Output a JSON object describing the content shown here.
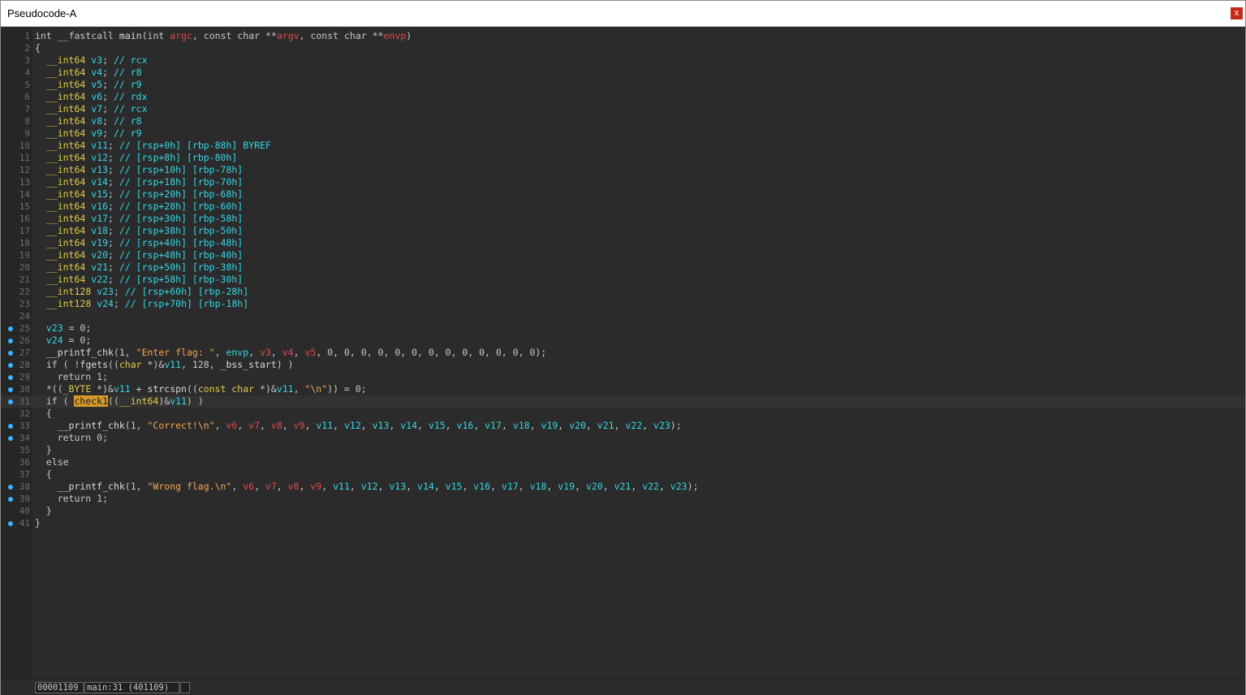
{
  "window": {
    "title": "Pseudocode-A",
    "close_label": "x"
  },
  "status": {
    "address": "00001109",
    "location": "main:31 (401109)",
    "extra": ""
  },
  "lines": [
    {
      "n": "1",
      "bp": false,
      "tokens": [
        [
          "k",
          "int"
        ],
        [
          "n",
          " "
        ],
        [
          "k",
          "__fastcall"
        ],
        [
          "n",
          " "
        ],
        [
          "f",
          "main"
        ],
        [
          "n",
          "("
        ],
        [
          "k",
          "int"
        ],
        [
          "n",
          " "
        ],
        [
          "a",
          "argc"
        ],
        [
          "n",
          ", "
        ],
        [
          "k",
          "const"
        ],
        [
          "n",
          " "
        ],
        [
          "k",
          "char"
        ],
        [
          "n",
          " **"
        ],
        [
          "a",
          "argv"
        ],
        [
          "n",
          ", "
        ],
        [
          "k",
          "const"
        ],
        [
          "n",
          " "
        ],
        [
          "k",
          "char"
        ],
        [
          "n",
          " **"
        ],
        [
          "a",
          "envp"
        ],
        [
          "n",
          ")"
        ]
      ]
    },
    {
      "n": "2",
      "bp": false,
      "tokens": [
        [
          "n",
          "{"
        ]
      ]
    },
    {
      "n": "3",
      "bp": false,
      "tokens": [
        [
          "n",
          "  "
        ],
        [
          "t",
          "__int64"
        ],
        [
          "n",
          " "
        ],
        [
          "v",
          "v3"
        ],
        [
          "n",
          "; "
        ],
        [
          "c",
          "// rcx"
        ]
      ]
    },
    {
      "n": "4",
      "bp": false,
      "tokens": [
        [
          "n",
          "  "
        ],
        [
          "t",
          "__int64"
        ],
        [
          "n",
          " "
        ],
        [
          "v",
          "v4"
        ],
        [
          "n",
          "; "
        ],
        [
          "c",
          "// r8"
        ]
      ]
    },
    {
      "n": "5",
      "bp": false,
      "tokens": [
        [
          "n",
          "  "
        ],
        [
          "t",
          "__int64"
        ],
        [
          "n",
          " "
        ],
        [
          "v",
          "v5"
        ],
        [
          "n",
          "; "
        ],
        [
          "c",
          "// r9"
        ]
      ]
    },
    {
      "n": "6",
      "bp": false,
      "tokens": [
        [
          "n",
          "  "
        ],
        [
          "t",
          "__int64"
        ],
        [
          "n",
          " "
        ],
        [
          "v",
          "v6"
        ],
        [
          "n",
          "; "
        ],
        [
          "c",
          "// rdx"
        ]
      ]
    },
    {
      "n": "7",
      "bp": false,
      "tokens": [
        [
          "n",
          "  "
        ],
        [
          "t",
          "__int64"
        ],
        [
          "n",
          " "
        ],
        [
          "v",
          "v7"
        ],
        [
          "n",
          "; "
        ],
        [
          "c",
          "// rcx"
        ]
      ]
    },
    {
      "n": "8",
      "bp": false,
      "tokens": [
        [
          "n",
          "  "
        ],
        [
          "t",
          "__int64"
        ],
        [
          "n",
          " "
        ],
        [
          "v",
          "v8"
        ],
        [
          "n",
          "; "
        ],
        [
          "c",
          "// r8"
        ]
      ]
    },
    {
      "n": "9",
      "bp": false,
      "tokens": [
        [
          "n",
          "  "
        ],
        [
          "t",
          "__int64"
        ],
        [
          "n",
          " "
        ],
        [
          "v",
          "v9"
        ],
        [
          "n",
          "; "
        ],
        [
          "c",
          "// r9"
        ]
      ]
    },
    {
      "n": "10",
      "bp": false,
      "tokens": [
        [
          "n",
          "  "
        ],
        [
          "t",
          "__int64"
        ],
        [
          "n",
          " "
        ],
        [
          "v",
          "v11"
        ],
        [
          "n",
          "; "
        ],
        [
          "c",
          "// [rsp+0h] [rbp-88h] BYREF"
        ]
      ]
    },
    {
      "n": "11",
      "bp": false,
      "tokens": [
        [
          "n",
          "  "
        ],
        [
          "t",
          "__int64"
        ],
        [
          "n",
          " "
        ],
        [
          "v",
          "v12"
        ],
        [
          "n",
          "; "
        ],
        [
          "c",
          "// [rsp+8h] [rbp-80h]"
        ]
      ]
    },
    {
      "n": "12",
      "bp": false,
      "tokens": [
        [
          "n",
          "  "
        ],
        [
          "t",
          "__int64"
        ],
        [
          "n",
          " "
        ],
        [
          "v",
          "v13"
        ],
        [
          "n",
          "; "
        ],
        [
          "c",
          "// [rsp+10h] [rbp-78h]"
        ]
      ]
    },
    {
      "n": "13",
      "bp": false,
      "tokens": [
        [
          "n",
          "  "
        ],
        [
          "t",
          "__int64"
        ],
        [
          "n",
          " "
        ],
        [
          "v",
          "v14"
        ],
        [
          "n",
          "; "
        ],
        [
          "c",
          "// [rsp+18h] [rbp-70h]"
        ]
      ]
    },
    {
      "n": "14",
      "bp": false,
      "tokens": [
        [
          "n",
          "  "
        ],
        [
          "t",
          "__int64"
        ],
        [
          "n",
          " "
        ],
        [
          "v",
          "v15"
        ],
        [
          "n",
          "; "
        ],
        [
          "c",
          "// [rsp+20h] [rbp-68h]"
        ]
      ]
    },
    {
      "n": "15",
      "bp": false,
      "tokens": [
        [
          "n",
          "  "
        ],
        [
          "t",
          "__int64"
        ],
        [
          "n",
          " "
        ],
        [
          "v",
          "v16"
        ],
        [
          "n",
          "; "
        ],
        [
          "c",
          "// [rsp+28h] [rbp-60h]"
        ]
      ]
    },
    {
      "n": "16",
      "bp": false,
      "tokens": [
        [
          "n",
          "  "
        ],
        [
          "t",
          "__int64"
        ],
        [
          "n",
          " "
        ],
        [
          "v",
          "v17"
        ],
        [
          "n",
          "; "
        ],
        [
          "c",
          "// [rsp+30h] [rbp-58h]"
        ]
      ]
    },
    {
      "n": "17",
      "bp": false,
      "tokens": [
        [
          "n",
          "  "
        ],
        [
          "t",
          "__int64"
        ],
        [
          "n",
          " "
        ],
        [
          "v",
          "v18"
        ],
        [
          "n",
          "; "
        ],
        [
          "c",
          "// [rsp+38h] [rbp-50h]"
        ]
      ]
    },
    {
      "n": "18",
      "bp": false,
      "tokens": [
        [
          "n",
          "  "
        ],
        [
          "t",
          "__int64"
        ],
        [
          "n",
          " "
        ],
        [
          "v",
          "v19"
        ],
        [
          "n",
          "; "
        ],
        [
          "c",
          "// [rsp+40h] [rbp-48h]"
        ]
      ]
    },
    {
      "n": "19",
      "bp": false,
      "tokens": [
        [
          "n",
          "  "
        ],
        [
          "t",
          "__int64"
        ],
        [
          "n",
          " "
        ],
        [
          "v",
          "v20"
        ],
        [
          "n",
          "; "
        ],
        [
          "c",
          "// [rsp+48h] [rbp-40h]"
        ]
      ]
    },
    {
      "n": "20",
      "bp": false,
      "tokens": [
        [
          "n",
          "  "
        ],
        [
          "t",
          "__int64"
        ],
        [
          "n",
          " "
        ],
        [
          "v",
          "v21"
        ],
        [
          "n",
          "; "
        ],
        [
          "c",
          "// [rsp+50h] [rbp-38h]"
        ]
      ]
    },
    {
      "n": "21",
      "bp": false,
      "tokens": [
        [
          "n",
          "  "
        ],
        [
          "t",
          "__int64"
        ],
        [
          "n",
          " "
        ],
        [
          "v",
          "v22"
        ],
        [
          "n",
          "; "
        ],
        [
          "c",
          "// [rsp+58h] [rbp-30h]"
        ]
      ]
    },
    {
      "n": "22",
      "bp": false,
      "tokens": [
        [
          "n",
          "  "
        ],
        [
          "t",
          "__int128"
        ],
        [
          "n",
          " "
        ],
        [
          "v",
          "v23"
        ],
        [
          "n",
          "; "
        ],
        [
          "c",
          "// [rsp+60h] [rbp-28h]"
        ]
      ]
    },
    {
      "n": "23",
      "bp": false,
      "tokens": [
        [
          "n",
          "  "
        ],
        [
          "t",
          "__int128"
        ],
        [
          "n",
          " "
        ],
        [
          "v",
          "v24"
        ],
        [
          "n",
          "; "
        ],
        [
          "c",
          "// [rsp+70h] [rbp-18h]"
        ]
      ]
    },
    {
      "n": "24",
      "bp": false,
      "tokens": []
    },
    {
      "n": "25",
      "bp": true,
      "tokens": [
        [
          "n",
          "  "
        ],
        [
          "v",
          "v23"
        ],
        [
          "n",
          " = 0;"
        ]
      ]
    },
    {
      "n": "26",
      "bp": true,
      "tokens": [
        [
          "n",
          "  "
        ],
        [
          "v",
          "v24"
        ],
        [
          "n",
          " = 0;"
        ]
      ]
    },
    {
      "n": "27",
      "bp": true,
      "tokens": [
        [
          "n",
          "  "
        ],
        [
          "f",
          "__printf_chk"
        ],
        [
          "n",
          "(1, "
        ],
        [
          "s",
          "\"Enter flag: \""
        ],
        [
          "n",
          ", "
        ],
        [
          "v",
          "envp"
        ],
        [
          "n",
          ", "
        ],
        [
          "a",
          "v3"
        ],
        [
          "n",
          ", "
        ],
        [
          "a",
          "v4"
        ],
        [
          "n",
          ", "
        ],
        [
          "a",
          "v5"
        ],
        [
          "n",
          ", 0, 0, 0, 0, 0, 0, 0, 0, 0, 0, 0, 0, 0);"
        ]
      ]
    },
    {
      "n": "28",
      "bp": true,
      "tokens": [
        [
          "n",
          "  if ( !"
        ],
        [
          "f",
          "fgets"
        ],
        [
          "n",
          "(("
        ],
        [
          "t",
          "char"
        ],
        [
          "n",
          " *)&"
        ],
        [
          "v",
          "v11"
        ],
        [
          "n",
          ", 128, "
        ],
        [
          "f",
          "_bss_start"
        ],
        [
          "n",
          ") )"
        ]
      ]
    },
    {
      "n": "29",
      "bp": true,
      "tokens": [
        [
          "n",
          "    return 1;"
        ]
      ]
    },
    {
      "n": "30",
      "bp": true,
      "tokens": [
        [
          "n",
          "  *(("
        ],
        [
          "t",
          "_BYTE"
        ],
        [
          "n",
          " *)&"
        ],
        [
          "v",
          "v11"
        ],
        [
          "n",
          " + "
        ],
        [
          "f",
          "strcspn"
        ],
        [
          "n",
          "(("
        ],
        [
          "t",
          "const char"
        ],
        [
          "n",
          " *)&"
        ],
        [
          "v",
          "v11"
        ],
        [
          "n",
          ", "
        ],
        [
          "s",
          "\"\\n\""
        ],
        [
          "n",
          ")) = 0;"
        ]
      ]
    },
    {
      "n": "31",
      "bp": true,
      "current": true,
      "tokens": [
        [
          "n",
          "  if ( "
        ],
        [
          "hl",
          "check1"
        ],
        [
          "br",
          "("
        ],
        [
          "n",
          "("
        ],
        [
          "t",
          "__int64"
        ],
        [
          "n",
          ")&"
        ],
        [
          "v",
          "v11"
        ],
        [
          "br",
          ")"
        ],
        [
          "n",
          " )"
        ]
      ]
    },
    {
      "n": "32",
      "bp": false,
      "tokens": [
        [
          "n",
          "  {"
        ]
      ]
    },
    {
      "n": "33",
      "bp": true,
      "tokens": [
        [
          "n",
          "    "
        ],
        [
          "f",
          "__printf_chk"
        ],
        [
          "n",
          "(1, "
        ],
        [
          "s",
          "\"Correct!\\n\""
        ],
        [
          "n",
          ", "
        ],
        [
          "a",
          "v6"
        ],
        [
          "n",
          ", "
        ],
        [
          "a",
          "v7"
        ],
        [
          "n",
          ", "
        ],
        [
          "a",
          "v8"
        ],
        [
          "n",
          ", "
        ],
        [
          "a",
          "v9"
        ],
        [
          "n",
          ", "
        ],
        [
          "v",
          "v11"
        ],
        [
          "n",
          ", "
        ],
        [
          "v",
          "v12"
        ],
        [
          "n",
          ", "
        ],
        [
          "v",
          "v13"
        ],
        [
          "n",
          ", "
        ],
        [
          "v",
          "v14"
        ],
        [
          "n",
          ", "
        ],
        [
          "v",
          "v15"
        ],
        [
          "n",
          ", "
        ],
        [
          "v",
          "v16"
        ],
        [
          "n",
          ", "
        ],
        [
          "v",
          "v17"
        ],
        [
          "n",
          ", "
        ],
        [
          "v",
          "v18"
        ],
        [
          "n",
          ", "
        ],
        [
          "v",
          "v19"
        ],
        [
          "n",
          ", "
        ],
        [
          "v",
          "v20"
        ],
        [
          "n",
          ", "
        ],
        [
          "v",
          "v21"
        ],
        [
          "n",
          ", "
        ],
        [
          "v",
          "v22"
        ],
        [
          "n",
          ", "
        ],
        [
          "v",
          "v23"
        ],
        [
          "n",
          ");"
        ]
      ]
    },
    {
      "n": "34",
      "bp": true,
      "tokens": [
        [
          "n",
          "    return 0;"
        ]
      ]
    },
    {
      "n": "35",
      "bp": false,
      "tokens": [
        [
          "n",
          "  }"
        ]
      ]
    },
    {
      "n": "36",
      "bp": false,
      "tokens": [
        [
          "n",
          "  else"
        ]
      ]
    },
    {
      "n": "37",
      "bp": false,
      "tokens": [
        [
          "n",
          "  {"
        ]
      ]
    },
    {
      "n": "38",
      "bp": true,
      "tokens": [
        [
          "n",
          "    "
        ],
        [
          "f",
          "__printf_chk"
        ],
        [
          "n",
          "(1, "
        ],
        [
          "s",
          "\"Wrong flag.\\n\""
        ],
        [
          "n",
          ", "
        ],
        [
          "a",
          "v6"
        ],
        [
          "n",
          ", "
        ],
        [
          "a",
          "v7"
        ],
        [
          "n",
          ", "
        ],
        [
          "a",
          "v8"
        ],
        [
          "n",
          ", "
        ],
        [
          "a",
          "v9"
        ],
        [
          "n",
          ", "
        ],
        [
          "v",
          "v11"
        ],
        [
          "n",
          ", "
        ],
        [
          "v",
          "v12"
        ],
        [
          "n",
          ", "
        ],
        [
          "v",
          "v13"
        ],
        [
          "n",
          ", "
        ],
        [
          "v",
          "v14"
        ],
        [
          "n",
          ", "
        ],
        [
          "v",
          "v15"
        ],
        [
          "n",
          ", "
        ],
        [
          "v",
          "v16"
        ],
        [
          "n",
          ", "
        ],
        [
          "v",
          "v17"
        ],
        [
          "n",
          ", "
        ],
        [
          "v",
          "v18"
        ],
        [
          "n",
          ", "
        ],
        [
          "v",
          "v19"
        ],
        [
          "n",
          ", "
        ],
        [
          "v",
          "v20"
        ],
        [
          "n",
          ", "
        ],
        [
          "v",
          "v21"
        ],
        [
          "n",
          ", "
        ],
        [
          "v",
          "v22"
        ],
        [
          "n",
          ", "
        ],
        [
          "v",
          "v23"
        ],
        [
          "n",
          ");"
        ]
      ]
    },
    {
      "n": "39",
      "bp": true,
      "tokens": [
        [
          "n",
          "    return 1;"
        ]
      ]
    },
    {
      "n": "40",
      "bp": false,
      "tokens": [
        [
          "n",
          "  }"
        ]
      ]
    },
    {
      "n": "41",
      "bp": true,
      "tokens": [
        [
          "n",
          "}"
        ]
      ]
    }
  ]
}
